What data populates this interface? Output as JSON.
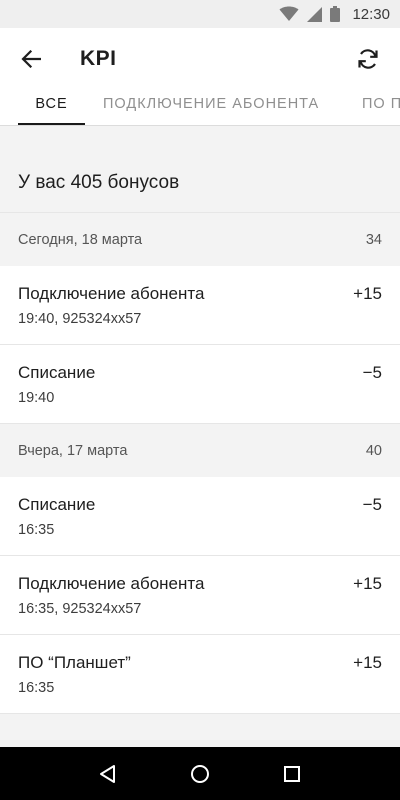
{
  "status_bar": {
    "time": "12:30",
    "icons": [
      "wifi-icon",
      "signal-icon",
      "battery-icon"
    ]
  },
  "app_bar": {
    "title": "KPI",
    "back_icon": "arrow-left-icon",
    "refresh_icon": "refresh-icon"
  },
  "tabs": [
    {
      "label": "Все",
      "active": true
    },
    {
      "label": "Подключение абонента",
      "active": false
    },
    {
      "label": "ПО П",
      "active": false
    }
  ],
  "summary": "У вас 405 бонусов",
  "days": [
    {
      "header": "Сегодня, 18 марта",
      "total": "34",
      "entries": [
        {
          "title": "Подключение абонента",
          "subtitle": "19:40, 925324xx57",
          "amount": "+15"
        },
        {
          "title": "Списание",
          "subtitle": "19:40",
          "amount": "−5"
        }
      ]
    },
    {
      "header": "Вчера, 17 марта",
      "total": "40",
      "entries": [
        {
          "title": "Списание",
          "subtitle": "16:35",
          "amount": "−5"
        },
        {
          "title": "Подключение абонента",
          "subtitle": "16:35, 925324xx57",
          "amount": "+15"
        },
        {
          "title": "ПО “Планшет”",
          "subtitle": "16:35",
          "amount": "+15"
        }
      ]
    }
  ],
  "colors": {
    "background": "#f3f3f3",
    "surface": "#ffffff",
    "text": "#212121",
    "muted": "#8f8f8f",
    "nav_bar": "#000000"
  },
  "nav_bar": {
    "icons": [
      "back-triangle-icon",
      "home-circle-icon",
      "recents-square-icon"
    ]
  }
}
